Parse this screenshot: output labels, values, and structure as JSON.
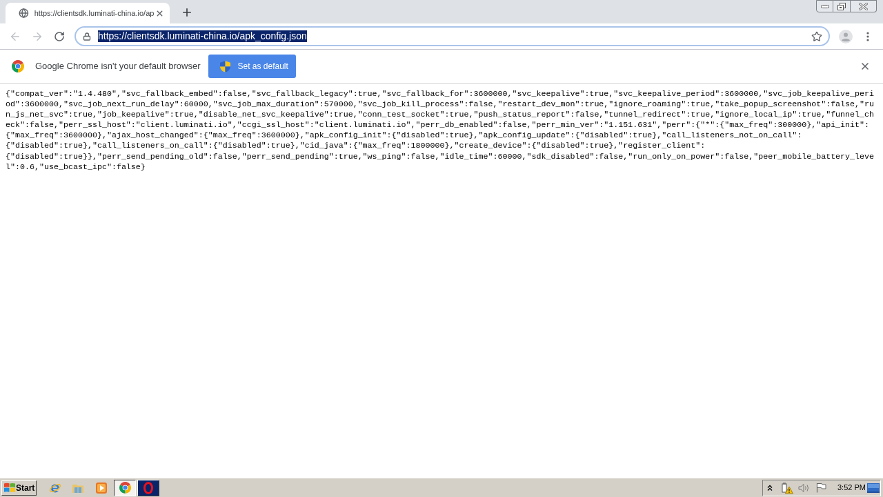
{
  "tab_strip": {
    "tabs": [
      {
        "title": "https://clientsdk.luminati-china.io/ap",
        "selected": true
      }
    ]
  },
  "toolbar": {
    "nav_buttons": [
      {
        "kind": "back",
        "disabled": true
      },
      {
        "kind": "forward",
        "disabled": true
      },
      {
        "kind": "reload",
        "disabled": false
      }
    ],
    "address_bar": {
      "url": "https://clientsdk.luminati-china.io/apk_config.json",
      "text_selected": true
    }
  },
  "infobar": {
    "message": "Google Chrome isn't your default browser",
    "button": "Set as default"
  },
  "page": {
    "json_text": "{\"compat_ver\":\"1.4.480\",\"svc_fallback_embed\":false,\"svc_fallback_legacy\":true,\"svc_fallback_for\":3600000,\"svc_keepalive\":true,\"svc_keepalive_period\":3600000,\"svc_job_keepalive_period\":3600000,\"svc_job_next_run_delay\":60000,\"svc_job_max_duration\":570000,\"svc_job_kill_process\":false,\"restart_dev_mon\":true,\"ignore_roaming\":true,\"take_popup_screenshot\":false,\"run_js_net_svc\":true,\"job_keepalive\":true,\"disable_net_svc_keepalive\":true,\"conn_test_socket\":true,\"push_status_report\":false,\"tunnel_redirect\":true,\"ignore_local_ip\":true,\"funnel_check\":false,\"perr_ssl_host\":\"client.luminati.io\",\"ccgi_ssl_host\":\"client.luminati.io\",\"perr_db_enabled\":false,\"perr_min_ver\":\"1.151.631\",\"perr\":{\"*\":{\"max_freq\":300000},\"api_init\":{\"max_freq\":3600000},\"ajax_host_changed\":{\"max_freq\":3600000},\"apk_config_init\":{\"disabled\":true},\"apk_config_update\":{\"disabled\":true},\"call_listeners_not_on_call\":{\"disabled\":true},\"call_listeners_on_call\":{\"disabled\":true},\"cid_java\":{\"max_freq\":1800000},\"create_device\":{\"disabled\":true},\"register_client\":{\"disabled\":true}},\"perr_send_pending_old\":false,\"perr_send_pending\":true,\"ws_ping\":false,\"idle_time\":60000,\"sdk_disabled\":false,\"run_only_on_power\":false,\"peer_mobile_battery_level\":0.6,\"use_bcast_ipc\":false}"
  },
  "taskbar": {
    "start_label": "Start",
    "tasks": [
      {
        "kind": "chrome",
        "selected": true,
        "highlighted": false
      },
      {
        "kind": "opera",
        "selected": false,
        "highlighted": true
      }
    ],
    "clock": "3:52 PM"
  }
}
